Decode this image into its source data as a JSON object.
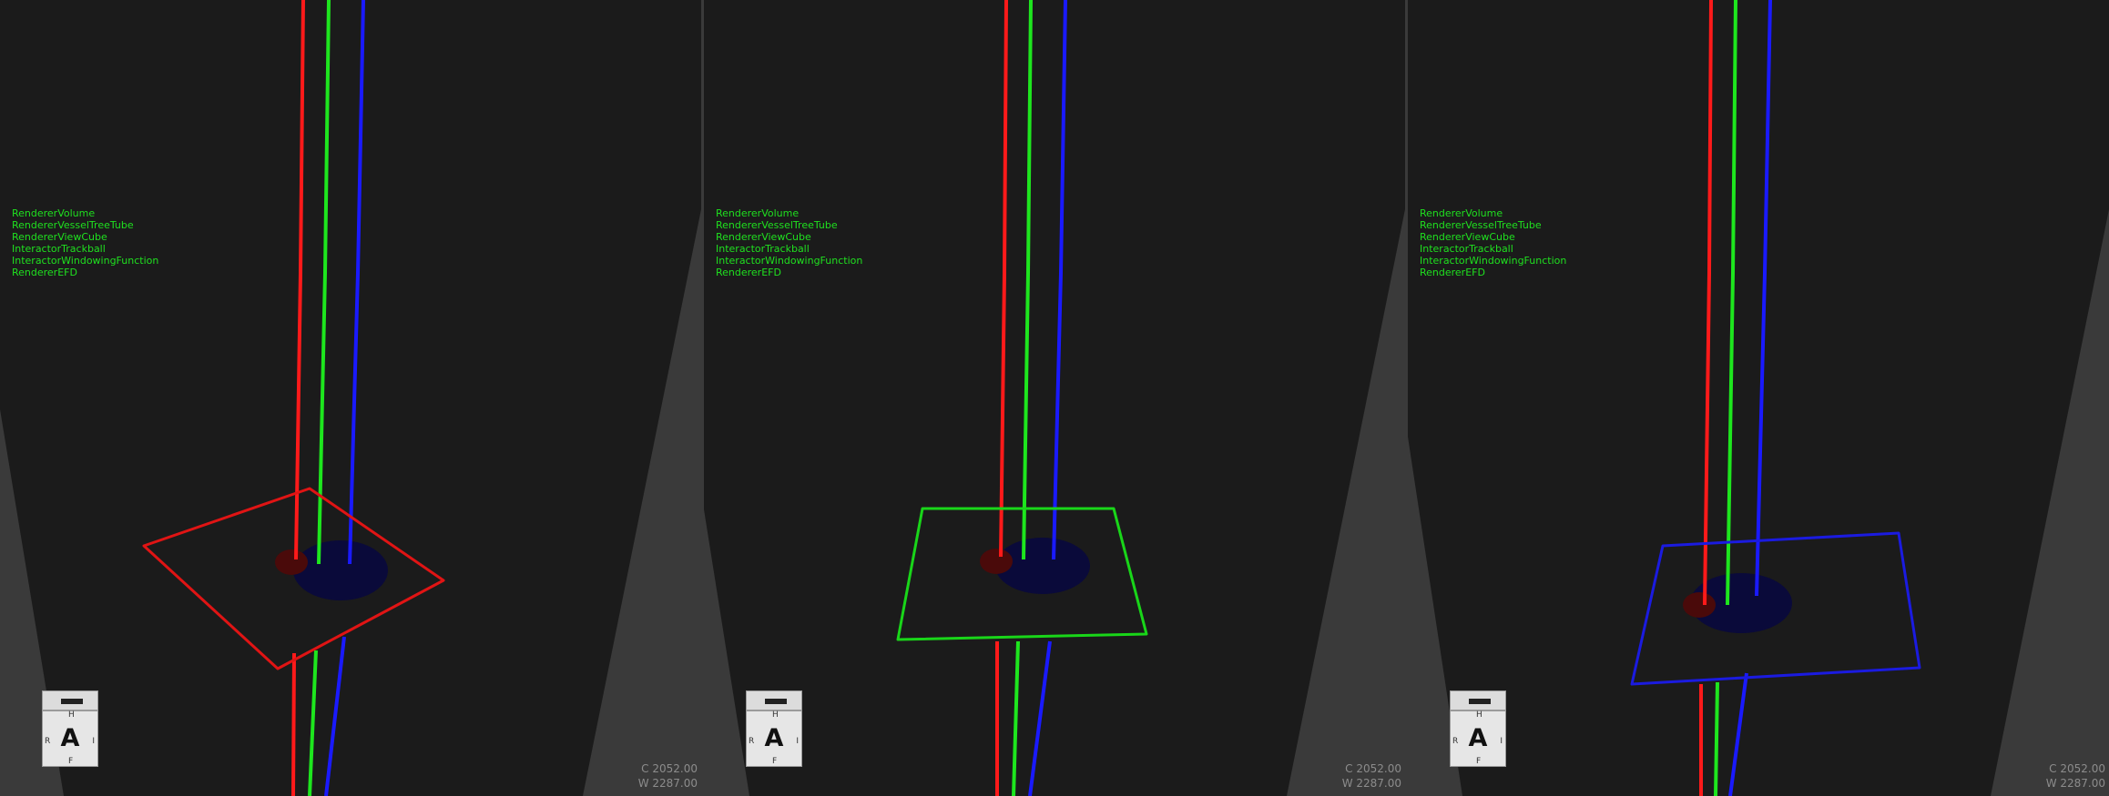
{
  "viewports": [
    {
      "id": "left",
      "renderers": [
        "RendererVolume",
        "RendererVesselTreeTube",
        "RendererViewCube",
        "InteractorTrackball",
        "InteractorWindowingFunction",
        "RendererEFD"
      ],
      "center_label": "C 2052.00",
      "width_label": "W 2287.00",
      "plane_color": "#e01414",
      "viewcube": {
        "face_letter": "A",
        "top_label": "H",
        "bottom_label": "F",
        "left_label": "R",
        "right_label": "I"
      }
    },
    {
      "id": "middle",
      "renderers": [
        "RendererVolume",
        "RendererVesselTreeTube",
        "RendererViewCube",
        "InteractorTrackball",
        "InteractorWindowingFunction",
        "RendererEFD"
      ],
      "center_label": "C 2052.00",
      "width_label": "W 2287.00",
      "plane_color": "#19d619",
      "viewcube": {
        "face_letter": "A",
        "top_label": "H",
        "bottom_label": "F",
        "left_label": "R",
        "right_label": "I"
      }
    },
    {
      "id": "right",
      "renderers": [
        "RendererVolume",
        "RendererVesselTreeTube",
        "RendererViewCube",
        "InteractorTrackball",
        "InteractorWindowingFunction",
        "RendererEFD"
      ],
      "center_label": "C 2052.00",
      "width_label": "W 2287.00",
      "plane_color": "#1b1be0",
      "viewcube": {
        "face_letter": "A",
        "top_label": "H",
        "bottom_label": "F",
        "left_label": "R",
        "right_label": "I"
      }
    }
  ],
  "axis_colors": {
    "x": "#ff1a1a",
    "y": "#1ee61e",
    "z": "#1a1aff"
  }
}
